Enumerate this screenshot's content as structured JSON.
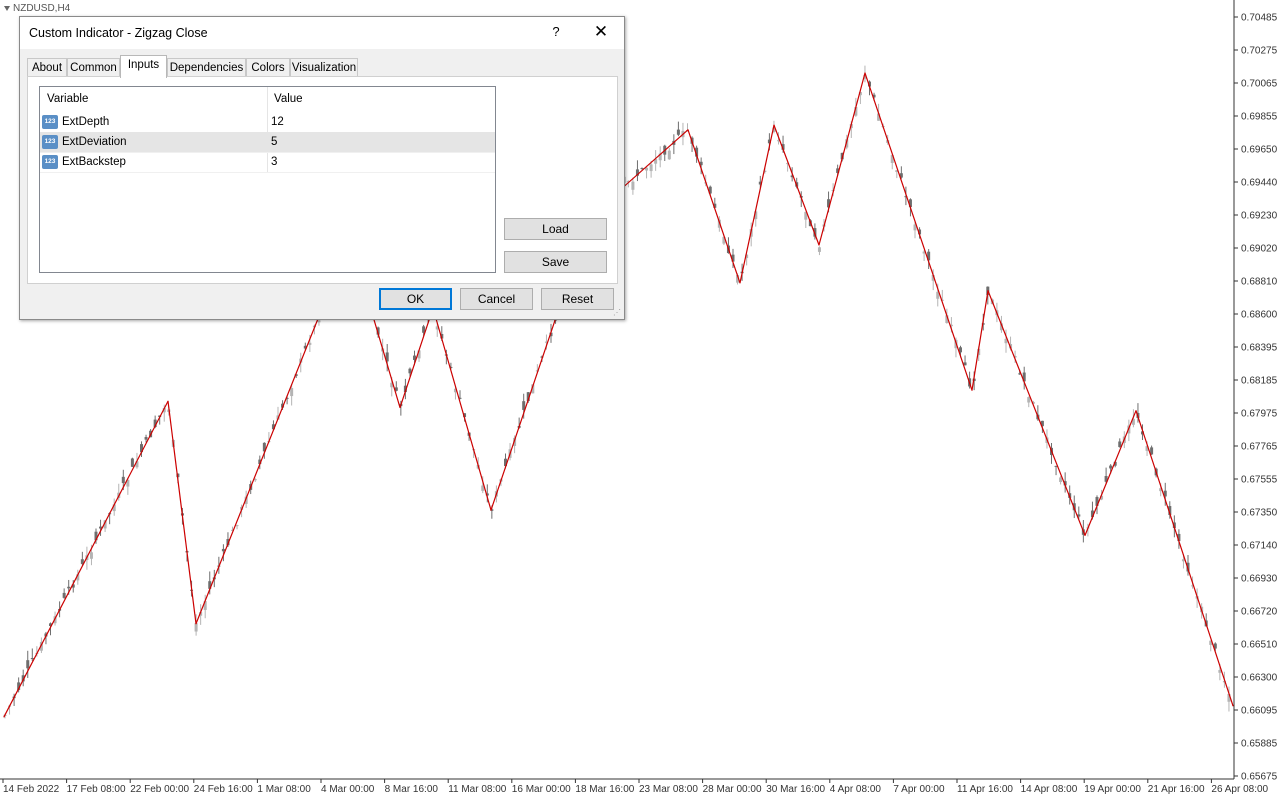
{
  "chart": {
    "symbol_label": "NZDUSD,H4",
    "price_ticks": [
      "0.70485",
      "0.70275",
      "0.70065",
      "0.69855",
      "0.69650",
      "0.69440",
      "0.69230",
      "0.69020",
      "0.68810",
      "0.68600",
      "0.68395",
      "0.68185",
      "0.67975",
      "0.67765",
      "0.67555",
      "0.67350",
      "0.67140",
      "0.66930",
      "0.66720",
      "0.66510",
      "0.66300",
      "0.66095",
      "0.65885",
      "0.65675"
    ],
    "time_ticks": [
      "14 Feb 2022",
      "17 Feb 08:00",
      "22 Feb 00:00",
      "24 Feb 16:00",
      "1 Mar 08:00",
      "4 Mar 00:00",
      "8 Mar 16:00",
      "11 Mar 08:00",
      "16 Mar 00:00",
      "18 Mar 16:00",
      "23 Mar 08:00",
      "28 Mar 00:00",
      "30 Mar 16:00",
      "4 Apr 08:00",
      "7 Apr 00:00",
      "11 Apr 16:00",
      "14 Apr 08:00",
      "19 Apr 00:00",
      "21 Apr 16:00",
      "26 Apr 08:00"
    ],
    "colors": {
      "bull_candle": "#b4b4b4",
      "bear_candle": "#6e6e6e",
      "zigzag": "#cc0000",
      "axis": "#333333"
    }
  },
  "chart_data": {
    "type": "candlestick",
    "indicator": "Zigzag Close",
    "zigzag_points": [
      {
        "x": "14 Feb 2022",
        "y": 0.6605
      },
      {
        "x": "22 Feb 04:00",
        "y": 0.6805
      },
      {
        "x": "24 Feb 16:00",
        "y": 0.6664
      },
      {
        "x": "4 Mar 08:00",
        "y": 0.6908
      },
      {
        "x": "8 Mar 16:00",
        "y": 0.6801
      },
      {
        "x": "10 Mar 08:00",
        "y": 0.6864
      },
      {
        "x": "14 Mar 20:00",
        "y": 0.6736
      },
      {
        "x": "21 Mar 16:00",
        "y": 0.6922
      },
      {
        "x": "24 Mar 08:00",
        "y": 0.6977
      },
      {
        "x": "28 Mar 20:00",
        "y": 0.688
      },
      {
        "x": "30 Mar 16:00",
        "y": 0.698
      },
      {
        "x": "1 Apr 12:00",
        "y": 0.6904
      },
      {
        "x": "4 Apr 16:00",
        "y": 0.7013
      },
      {
        "x": "11 Apr 08:00",
        "y": 0.6812
      },
      {
        "x": "12 Apr 04:00",
        "y": 0.6875
      },
      {
        "x": "18 Apr 12:00",
        "y": 0.672
      },
      {
        "x": "20 Apr 20:00",
        "y": 0.6799
      },
      {
        "x": "26 Apr 16:00",
        "y": 0.6612
      }
    ],
    "ylim": [
      0.65675,
      0.70485
    ],
    "grid": false
  },
  "dialog": {
    "title": "Custom Indicator - Zigzag Close",
    "help_glyph": "?",
    "close_glyph": "✕",
    "tabs": [
      "About",
      "Common",
      "Inputs",
      "Dependencies",
      "Colors",
      "Visualization"
    ],
    "active_tab": "Inputs",
    "table": {
      "col_variable": "Variable",
      "col_value": "Value",
      "icon_text": "123",
      "rows": [
        {
          "name": "ExtDepth",
          "value": "12"
        },
        {
          "name": "ExtDeviation",
          "value": "5"
        },
        {
          "name": "ExtBackstep",
          "value": "3"
        }
      ]
    },
    "buttons": {
      "load": "Load",
      "save": "Save",
      "ok": "OK",
      "cancel": "Cancel",
      "reset": "Reset"
    }
  }
}
